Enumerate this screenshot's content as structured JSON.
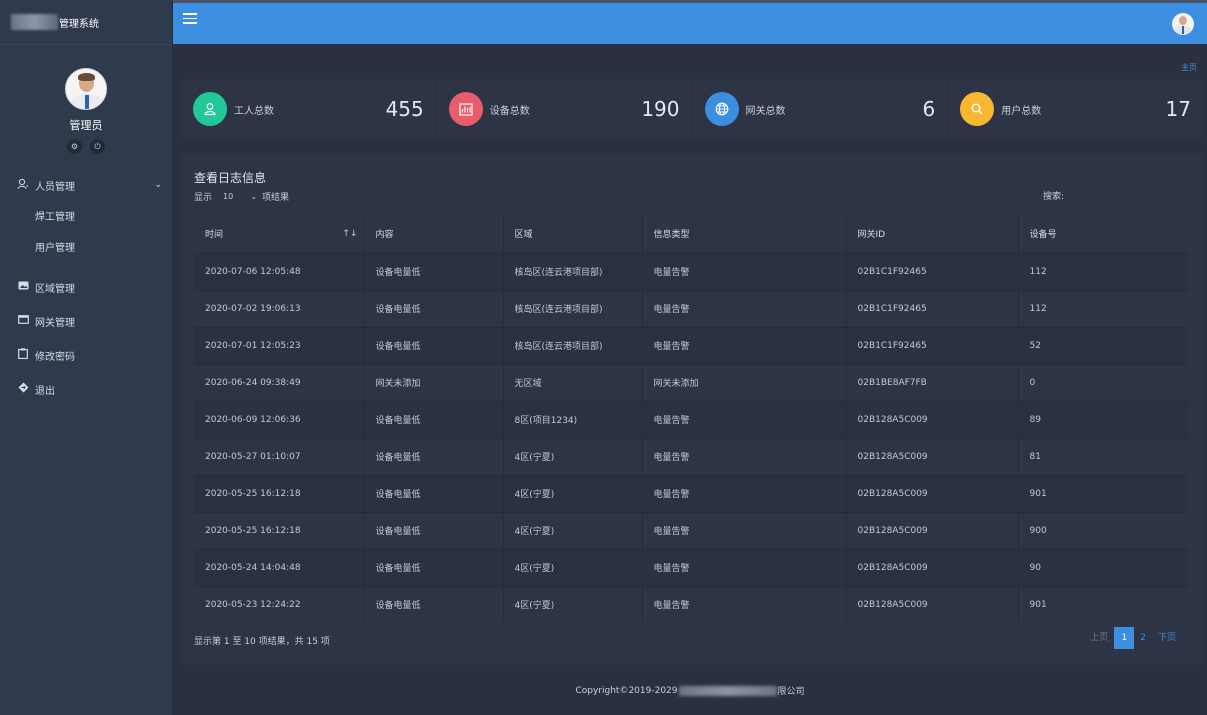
{
  "app": {
    "title": "管理系统"
  },
  "user": {
    "name": "管理员"
  },
  "sidebar": {
    "items": [
      {
        "label": "人员管理",
        "icon": "user-icon"
      },
      {
        "label": "焊工管理"
      },
      {
        "label": "用户管理"
      },
      {
        "label": "区域管理",
        "icon": "image-icon"
      },
      {
        "label": "网关管理",
        "icon": "window-icon"
      },
      {
        "label": "修改密码",
        "icon": "clipboard-icon"
      },
      {
        "label": "退出",
        "icon": "diamond-icon"
      }
    ]
  },
  "breadcrumb": {
    "home": "主页"
  },
  "stats": [
    {
      "label": "工人总数",
      "value": "455",
      "color": "#20c997",
      "icon": "person-icon"
    },
    {
      "label": "设备总数",
      "value": "190",
      "color": "#e85d6a",
      "icon": "chart-icon"
    },
    {
      "label": "网关总数",
      "value": "6",
      "color": "#3b8ee0",
      "icon": "globe-icon"
    },
    {
      "label": "用户总数",
      "value": "17",
      "color": "#f7b731",
      "icon": "search-icon"
    }
  ],
  "panel": {
    "title": "查看日志信息",
    "show_prefix": "显示",
    "page_size": "10",
    "show_suffix": "项结果",
    "search_label": "搜索:",
    "search_value": ""
  },
  "table": {
    "headers": [
      "时间",
      "内容",
      "区域",
      "信息类型",
      "网关ID",
      "设备号"
    ],
    "rows": [
      [
        "2020-07-06 12:05:48",
        "设备电量低",
        "核岛区(连云港项目部)",
        "电量告警",
        "02B1C1F92465",
        "112"
      ],
      [
        "2020-07-02 19:06:13",
        "设备电量低",
        "核岛区(连云港项目部)",
        "电量告警",
        "02B1C1F92465",
        "112"
      ],
      [
        "2020-07-01 12:05:23",
        "设备电量低",
        "核岛区(连云港项目部)",
        "电量告警",
        "02B1C1F92465",
        "52"
      ],
      [
        "2020-06-24 09:38:49",
        "网关未添加",
        "无区域",
        "网关未添加",
        "02B1BE8AF7FB",
        "0"
      ],
      [
        "2020-06-09 12:06:36",
        "设备电量低",
        "8区(项目1234)",
        "电量告警",
        "02B128A5C009",
        "89"
      ],
      [
        "2020-05-27 01:10:07",
        "设备电量低",
        "4区(宁夏)",
        "电量告警",
        "02B128A5C009",
        "81"
      ],
      [
        "2020-05-25 16:12:18",
        "设备电量低",
        "4区(宁夏)",
        "电量告警",
        "02B128A5C009",
        "901"
      ],
      [
        "2020-05-25 16:12:18",
        "设备电量低",
        "4区(宁夏)",
        "电量告警",
        "02B128A5C009",
        "900"
      ],
      [
        "2020-05-24 14:04:48",
        "设备电量低",
        "4区(宁夏)",
        "电量告警",
        "02B128A5C009",
        "90"
      ],
      [
        "2020-05-23 12:24:22",
        "设备电量低",
        "4区(宁夏)",
        "电量告警",
        "02B128A5C009",
        "901"
      ]
    ]
  },
  "pagination": {
    "info": "显示第 1 至 10 项结果，共 15 项",
    "prev": "上页",
    "pages": [
      "1",
      "2"
    ],
    "next": "下页"
  },
  "footer": {
    "left": "Copyright©2019-2029",
    "right": "限公司"
  }
}
